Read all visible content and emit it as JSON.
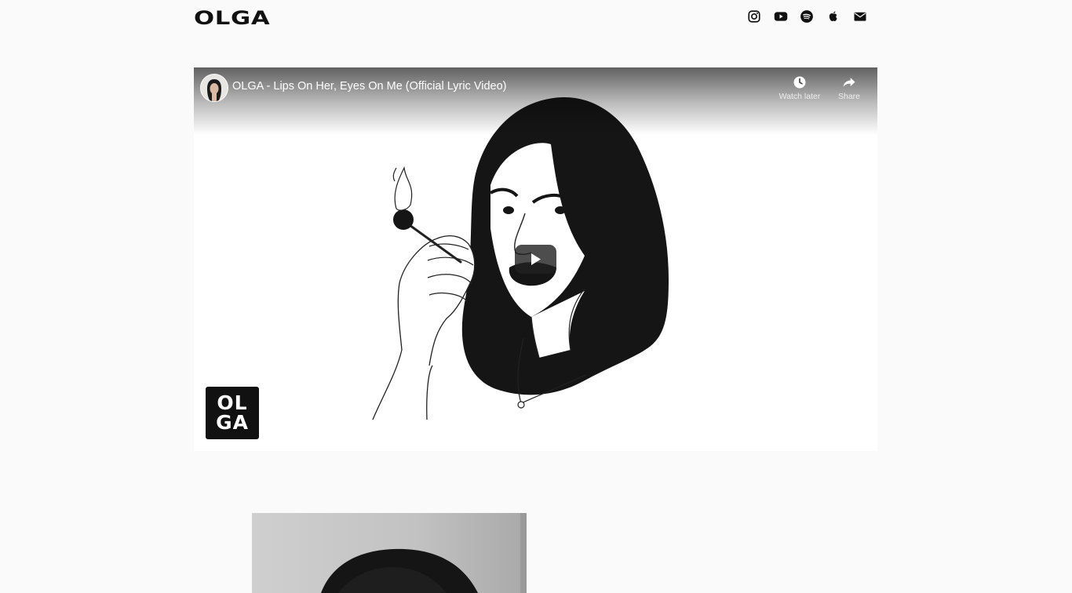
{
  "header": {
    "logo_text": "OLGA",
    "social_icons": [
      "instagram-icon",
      "youtube-icon",
      "spotify-icon",
      "apple-icon",
      "email-icon"
    ]
  },
  "video": {
    "title": "OLGA - Lips On Her, Eyes On Me (Official Lyric Video)",
    "watch_later_label": "Watch later",
    "share_label": "Share",
    "badge_line1": "OL",
    "badge_line2": "GA"
  },
  "colors": {
    "background": "#fafafa",
    "text": "#111111",
    "play_button": "#212121"
  }
}
